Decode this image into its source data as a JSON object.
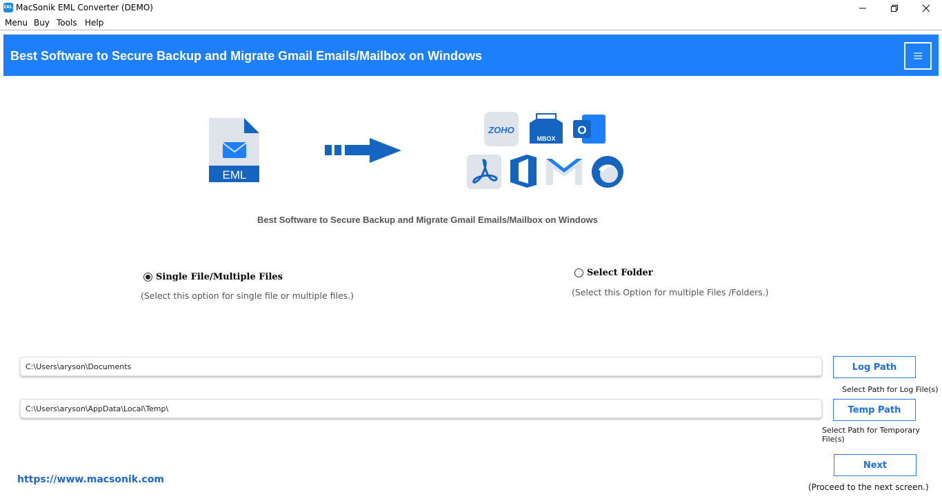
{
  "window": {
    "title": "MacSonik EML Converter (DEMO)",
    "icon_text": "EML"
  },
  "menu": [
    "Menu",
    "Buy",
    "Tools",
    "Help"
  ],
  "banner": {
    "title": "Best Software to Secure Backup and Migrate Gmail Emails/Mailbox on Windows",
    "menu_icon": "hamburger-icon"
  },
  "illustration": {
    "source_label": "EML",
    "mbox_label": "MBOX",
    "zoho_label": "ZOHO",
    "outlook_label": "O"
  },
  "subtitle": "Best Software to Secure Backup and Migrate Gmail Emails/Mailbox on Windows",
  "options": {
    "single": {
      "label": "Single File/Multiple Files",
      "desc": "(Select this option for single file or multiple files.)",
      "selected": true
    },
    "folder": {
      "label": "Select Folder",
      "desc": "(Select this Option for multiple Files /Folders.)",
      "selected": false
    }
  },
  "log": {
    "path": "C:\\Users\\aryson\\Documents",
    "button": "Log Path",
    "hint": "Select Path for Log File(s)"
  },
  "temp": {
    "path": "C:\\Users\\aryson\\AppData\\Local\\Temp\\",
    "button": "Temp Path",
    "hint": "Select Path for Temporary File(s)"
  },
  "next": {
    "button": "Next",
    "hint": "(Proceed to the next screen.)"
  },
  "website": "https://www.macsonik.com",
  "colors": {
    "banner": "#1e7ffb",
    "accent": "#1e6fd9"
  }
}
